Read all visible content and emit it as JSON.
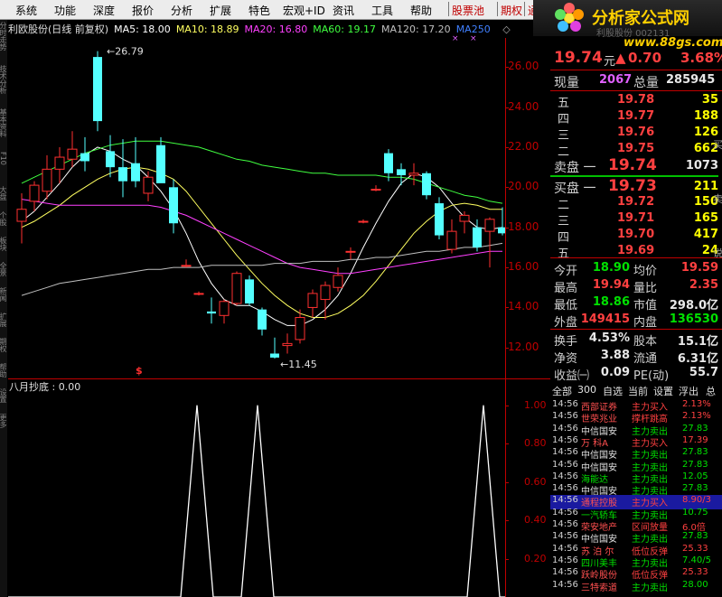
{
  "menu": {
    "items": [
      "系统",
      "功能",
      "深度",
      "报价",
      "分析",
      "扩展",
      "特色",
      "宏观+ID",
      "资讯",
      "工具",
      "帮助"
    ],
    "special": [
      "股票池",
      "期权",
      "通"
    ]
  },
  "logo": {
    "text": "分析家公式网",
    "sub": "利股股份 002131",
    "url": "www.88gs.com"
  },
  "sidebar": {
    "labels": [
      "分时走势",
      "技术分析",
      "基本资料",
      "F10",
      "大盘",
      "个股",
      "板块",
      "全景",
      "新闻",
      "扩展",
      "期权",
      "帮助",
      "设置",
      "更多"
    ]
  },
  "chart_header": {
    "title": "利欧股份(日线 前复权)",
    "ma": [
      {
        "label": "MA5: 18.00",
        "color": "#ffffff"
      },
      {
        "label": "MA10: 18.89",
        "color": "#ffff60"
      },
      {
        "label": "MA20: 16.80",
        "color": "#ff40ff"
      },
      {
        "label": "MA60: 19.17",
        "color": "#40ff40"
      },
      {
        "label": "MA120: 17.20",
        "color": "#c0c0c0"
      },
      {
        "label": "MA250",
        "color": "#4080ff"
      }
    ],
    "diamond": "◇"
  },
  "chart_data": [
    {
      "type": "candlestick",
      "title": "利欧股份(日线 前复权)",
      "y_ticks": [
        "26.00",
        "24.00",
        "22.00",
        "20.00",
        "18.00",
        "16.00",
        "14.00",
        "12.00"
      ],
      "ylim": [
        11.0,
        27.0
      ],
      "annotations": [
        "26.79",
        "11.45"
      ],
      "up_color": "#ff3030",
      "down_color": "#54ffff",
      "candles": [
        {
          "o": 18.3,
          "h": 19.7,
          "l": 17.2,
          "c": 18.9
        },
        {
          "o": 19.3,
          "h": 20.3,
          "l": 18.8,
          "c": 20.1
        },
        {
          "o": 19.8,
          "h": 21.6,
          "l": 19.4,
          "c": 20.9
        },
        {
          "o": 20.9,
          "h": 22.0,
          "l": 20.2,
          "c": 21.5
        },
        {
          "o": 21.4,
          "h": 22.8,
          "l": 21.0,
          "c": 21.9
        },
        {
          "o": 21.7,
          "h": 22.5,
          "l": 20.8,
          "c": 21.3
        },
        {
          "o": 26.5,
          "h": 26.79,
          "l": 22.8,
          "c": 23.3
        },
        {
          "o": 21.8,
          "h": 22.6,
          "l": 20.5,
          "c": 21.0
        },
        {
          "o": 21.0,
          "h": 22.4,
          "l": 19.5,
          "c": 20.3
        },
        {
          "o": 21.2,
          "h": 22.5,
          "l": 20.0,
          "c": 20.3
        },
        {
          "o": 19.7,
          "h": 20.8,
          "l": 19.3,
          "c": 20.5
        },
        {
          "o": 22.1,
          "h": 22.5,
          "l": 20.4,
          "c": 20.2
        },
        {
          "o": 20.0,
          "h": 20.4,
          "l": 17.7,
          "c": 18.2
        },
        {
          "o": 16.1,
          "h": 16.4,
          "l": 16.0,
          "c": 16.1
        },
        {
          "o": 14.7,
          "h": 14.8,
          "l": 14.6,
          "c": 14.7
        },
        {
          "o": 13.8,
          "h": 14.5,
          "l": 13.2,
          "c": 13.7
        },
        {
          "o": 13.6,
          "h": 14.4,
          "l": 13.2,
          "c": 14.3
        },
        {
          "o": 14.2,
          "h": 15.8,
          "l": 14.1,
          "c": 15.7
        },
        {
          "o": 15.4,
          "h": 15.6,
          "l": 14.1,
          "c": 14.2
        },
        {
          "o": 13.9,
          "h": 14.0,
          "l": 12.6,
          "c": 12.9
        },
        {
          "o": 11.7,
          "h": 12.5,
          "l": 11.45,
          "c": 11.5
        },
        {
          "o": 12.1,
          "h": 12.7,
          "l": 11.7,
          "c": 12.2
        },
        {
          "o": 12.4,
          "h": 13.9,
          "l": 12.2,
          "c": 13.5
        },
        {
          "o": 14.0,
          "h": 14.9,
          "l": 13.5,
          "c": 14.7
        },
        {
          "o": 14.4,
          "h": 15.3,
          "l": 13.4,
          "c": 15.1
        },
        {
          "o": 15.0,
          "h": 16.0,
          "l": 14.8,
          "c": 15.6
        },
        {
          "o": 16.8,
          "h": 17.0,
          "l": 16.4,
          "c": 16.8
        },
        {
          "o": 18.3,
          "h": 18.4,
          "l": 18.2,
          "c": 18.3
        },
        {
          "o": 19.9,
          "h": 20.1,
          "l": 19.8,
          "c": 19.9
        },
        {
          "o": 21.7,
          "h": 21.9,
          "l": 20.3,
          "c": 20.7
        },
        {
          "o": 20.9,
          "h": 21.2,
          "l": 20.1,
          "c": 20.6
        },
        {
          "o": 20.6,
          "h": 21.2,
          "l": 20.1,
          "c": 20.7
        },
        {
          "o": 20.7,
          "h": 20.8,
          "l": 19.4,
          "c": 19.6
        },
        {
          "o": 19.2,
          "h": 19.5,
          "l": 17.4,
          "c": 17.6
        },
        {
          "o": 16.9,
          "h": 18.4,
          "l": 16.7,
          "c": 17.8
        },
        {
          "o": 18.3,
          "h": 18.8,
          "l": 17.7,
          "c": 18.6
        },
        {
          "o": 18.0,
          "h": 18.4,
          "l": 16.8,
          "c": 17.0
        },
        {
          "o": 17.8,
          "h": 18.5,
          "l": 16.0,
          "c": 18.4
        },
        {
          "o": 18.0,
          "h": 19.0,
          "l": 17.6,
          "c": 17.7
        }
      ],
      "ma_series": [
        {
          "name": "MA5",
          "color": "#ffffff",
          "values": [
            18.3,
            18.8,
            19.5,
            20.2,
            21.0,
            21.6,
            22.0,
            21.8,
            21.4,
            21.1,
            20.5,
            19.8,
            18.9,
            17.7,
            16.3,
            15.2,
            14.4,
            14.1,
            14.1,
            13.8,
            13.4,
            13.1,
            13.1,
            13.4,
            13.9,
            14.6,
            15.7,
            17.0,
            18.2,
            19.3,
            20.2,
            20.7,
            20.5,
            20.0,
            19.2,
            18.5,
            18.0,
            17.9,
            18.0
          ]
        },
        {
          "name": "MA10",
          "color": "#ffff60",
          "values": [
            18.0,
            18.3,
            18.7,
            19.1,
            19.6,
            20.0,
            20.4,
            20.7,
            20.9,
            21.0,
            20.9,
            20.7,
            20.4,
            19.8,
            19.0,
            18.2,
            17.4,
            16.6,
            15.9,
            15.2,
            14.6,
            14.1,
            13.7,
            13.5,
            13.5,
            13.7,
            14.1,
            14.6,
            15.3,
            16.1,
            16.9,
            17.7,
            18.3,
            18.8,
            19.1,
            19.2,
            19.1,
            18.9,
            18.9
          ]
        },
        {
          "name": "MA20",
          "color": "#ff40ff",
          "values": [
            19.4,
            19.3,
            19.2,
            19.1,
            19.1,
            19.1,
            19.1,
            19.1,
            19.1,
            19.1,
            19.1,
            19.0,
            18.8,
            18.6,
            18.3,
            18.0,
            17.7,
            17.4,
            17.1,
            16.8,
            16.5,
            16.2,
            16.0,
            15.9,
            15.8,
            15.7,
            15.7,
            15.8,
            15.9,
            16.0,
            16.1,
            16.2,
            16.3,
            16.4,
            16.5,
            16.6,
            16.7,
            16.8,
            16.8
          ]
        },
        {
          "name": "MA60",
          "color": "#40ff40",
          "values": [
            20.2,
            20.5,
            20.8,
            21.1,
            21.4,
            21.7,
            21.9,
            22.1,
            22.2,
            22.3,
            22.3,
            22.3,
            22.2,
            22.1,
            22.0,
            21.8,
            21.6,
            21.4,
            21.3,
            21.1,
            21.0,
            20.9,
            20.8,
            20.7,
            20.7,
            20.6,
            20.6,
            20.6,
            20.6,
            20.5,
            20.5,
            20.4,
            20.2,
            20.0,
            19.8,
            19.6,
            19.5,
            19.3,
            19.2
          ]
        },
        {
          "name": "MA120",
          "color": "#c0c0c0",
          "values": [
            14.6,
            14.8,
            15.0,
            15.2,
            15.3,
            15.4,
            15.5,
            15.6,
            15.7,
            15.8,
            15.9,
            15.9,
            16.0,
            16.0,
            16.0,
            16.1,
            16.1,
            16.1,
            16.1,
            16.1,
            16.2,
            16.2,
            16.2,
            16.3,
            16.3,
            16.3,
            16.4,
            16.4,
            16.5,
            16.5,
            16.6,
            16.7,
            16.8,
            16.8,
            16.9,
            17.0,
            17.0,
            17.1,
            17.2
          ]
        }
      ]
    },
    {
      "type": "line",
      "title": "八月抄底 : 0.00",
      "y_ticks": [
        "1.00",
        "0.80",
        "0.60",
        "0.40",
        "0.20"
      ],
      "ylim": [
        0,
        1.05
      ],
      "series": [
        {
          "color": "#ffffff",
          "values": [
            0,
            0,
            0,
            0,
            0,
            0,
            0,
            0,
            0,
            0,
            0,
            0,
            0,
            0,
            0,
            0,
            1,
            0,
            0,
            0,
            0,
            0,
            0,
            0,
            0,
            0,
            0,
            0,
            0,
            0,
            0,
            0,
            0,
            0,
            0,
            0,
            0,
            0,
            0,
            0,
            0,
            0,
            0,
            0,
            0,
            0,
            0,
            0,
            0,
            0,
            0,
            0,
            0,
            0,
            0,
            1,
            0,
            0,
            0,
            0,
            0,
            0,
            0,
            0,
            0,
            0,
            0,
            0,
            0,
            0,
            0,
            0,
            0,
            0,
            0,
            0,
            0,
            0,
            0,
            0,
            0,
            0,
            0,
            0,
            0,
            0,
            0,
            0,
            0,
            0,
            0,
            0,
            0,
            0,
            0,
            0,
            0,
            0,
            0,
            0,
            0,
            0,
            0,
            0,
            0,
            0,
            0,
            0,
            0,
            0,
            0,
            0,
            0,
            0,
            0,
            0,
            0,
            0,
            0,
            0,
            0,
            0,
            0,
            0,
            0,
            0,
            0,
            0,
            0,
            0,
            0,
            1,
            0,
            0,
            0,
            0,
            0,
            0,
            0,
            0,
            0
          ]
        }
      ]
    }
  ],
  "signal_mark": "$",
  "quote": {
    "price": "19.74",
    "unit": "元",
    "change": "0.70",
    "pct": "3.68%",
    "xianliang_label": "现量",
    "xianliang": "2067",
    "zongliang_label": "总量",
    "zongliang": "285945",
    "asks": [
      {
        "label": "五",
        "price": "19.78",
        "vol": "35"
      },
      {
        "label": "四",
        "price": "19.77",
        "vol": "188"
      },
      {
        "label": "三",
        "price": "19.76",
        "vol": "126"
      },
      {
        "label": "二",
        "price": "19.75",
        "vol": "662"
      }
    ],
    "ask1_label": "卖盘 一",
    "ask1_price": "19.74",
    "ask1_vol": "1073",
    "bid1_label": "买盘 一",
    "bid1_price": "19.73",
    "bid1_vol": "211",
    "bids": [
      {
        "label": "二",
        "price": "19.72",
        "vol": "150"
      },
      {
        "label": "三",
        "price": "19.71",
        "vol": "165"
      },
      {
        "label": "四",
        "price": "19.70",
        "vol": "417"
      },
      {
        "label": "五",
        "price": "19.69",
        "vol": "24"
      }
    ],
    "stats": [
      {
        "l1": "今开",
        "v1": "18.90",
        "c1": "green",
        "l2": "均价",
        "v2": "19.59",
        "c2": "red"
      },
      {
        "l1": "最高",
        "v1": "19.94",
        "c1": "red",
        "l2": "量比",
        "v2": "2.35",
        "c2": "red"
      },
      {
        "l1": "最低",
        "v1": "18.86",
        "c1": "green",
        "l2": "市值",
        "v2": "298.0亿",
        "c2": "white"
      },
      {
        "l1": "外盘",
        "v1": "149415",
        "c1": "red",
        "l2": "内盘",
        "v2": "136530",
        "c2": "green"
      }
    ],
    "stats2": [
      {
        "l1": "换手",
        "v1": "4.53%",
        "l2": "股本",
        "v2": "15.1亿"
      },
      {
        "l1": "净资",
        "v1": "3.88",
        "l2": "流通",
        "v2": "6.31亿"
      },
      {
        "l1": "收益㈠",
        "v1": "0.09",
        "l2": "PE(动)",
        "v2": "55.7"
      }
    ]
  },
  "tabs": [
    "全部",
    "300",
    "自选",
    "当前",
    "设置",
    "浮出",
    "总"
  ],
  "ticks": [
    {
      "time": "14:56",
      "name": "西部证券",
      "name_color": "#ff5050",
      "action": "主力买入",
      "action_color": "#ff4040",
      "val": "2.13%",
      "val_color": "#ff4040"
    },
    {
      "time": "14:56",
      "name": "世荣兆业",
      "name_color": "#ff5050",
      "action": "撑杆跳高",
      "action_color": "#ff4040",
      "val": "2.13%",
      "val_color": "#ff4040"
    },
    {
      "time": "14:56",
      "name": "中信国安",
      "name_color": "#e0e0e0",
      "action": "主力卖出",
      "action_color": "#00e000",
      "val": "27.83",
      "val_color": "#00e000"
    },
    {
      "time": "14:56",
      "name": "万 科A",
      "name_color": "#ff5050",
      "action": "主力买入",
      "action_color": "#ff4040",
      "val": "17.39",
      "val_color": "#ff4040"
    },
    {
      "time": "14:56",
      "name": "中信国安",
      "name_color": "#e0e0e0",
      "action": "主力卖出",
      "action_color": "#00e000",
      "val": "27.83",
      "val_color": "#00e000"
    },
    {
      "time": "14:56",
      "name": "中信国安",
      "name_color": "#e0e0e0",
      "action": "主力卖出",
      "action_color": "#00e000",
      "val": "27.83",
      "val_color": "#00e000"
    },
    {
      "time": "14:56",
      "name": "海能达",
      "name_color": "#00e000",
      "action": "主力卖出",
      "action_color": "#00e000",
      "val": "12.05",
      "val_color": "#00e000"
    },
    {
      "time": "14:56",
      "name": "中信国安",
      "name_color": "#e0e0e0",
      "action": "主力卖出",
      "action_color": "#00e000",
      "val": "27.83",
      "val_color": "#00e000"
    },
    {
      "time": "14:56",
      "name": "通程控股",
      "name_color": "#ff5050",
      "action": "主力买入",
      "action_color": "#ff4040",
      "val": "8.90/3",
      "val_color": "#ff4040",
      "highlight": true
    },
    {
      "time": "14:56",
      "name": "一汽轿车",
      "name_color": "#00e000",
      "action": "主力卖出",
      "action_color": "#00e000",
      "val": "10.75",
      "val_color": "#00e000"
    },
    {
      "time": "14:56",
      "name": "荣安地产",
      "name_color": "#ff5050",
      "action": "区间放量",
      "action_color": "#ff4040",
      "val": "6.0倍",
      "val_color": "#ff4040"
    },
    {
      "time": "14:56",
      "name": "中信国安",
      "name_color": "#e0e0e0",
      "action": "主力卖出",
      "action_color": "#00e000",
      "val": "27.83",
      "val_color": "#00e000"
    },
    {
      "time": "14:56",
      "name": "苏 泊 尔",
      "name_color": "#ff5050",
      "action": "低位反弹",
      "action_color": "#ff4040",
      "val": "25.33",
      "val_color": "#ff4040"
    },
    {
      "time": "14:56",
      "name": "四川美丰",
      "name_color": "#00e000",
      "action": "主力卖出",
      "action_color": "#00e000",
      "val": "7.40/5",
      "val_color": "#00e000"
    },
    {
      "time": "14:56",
      "name": "跃岭股份",
      "name_color": "#ff5050",
      "action": "低位反弹",
      "action_color": "#ff4040",
      "val": "25.33",
      "val_color": "#ff4040"
    },
    {
      "time": "14:56",
      "name": "三特索道",
      "name_color": "#ff5050",
      "action": "主力卖出",
      "action_color": "#00e000",
      "val": "28.00",
      "val_color": "#00e000"
    }
  ],
  "edge_labels": [
    "买",
    "卖",
    "说"
  ]
}
